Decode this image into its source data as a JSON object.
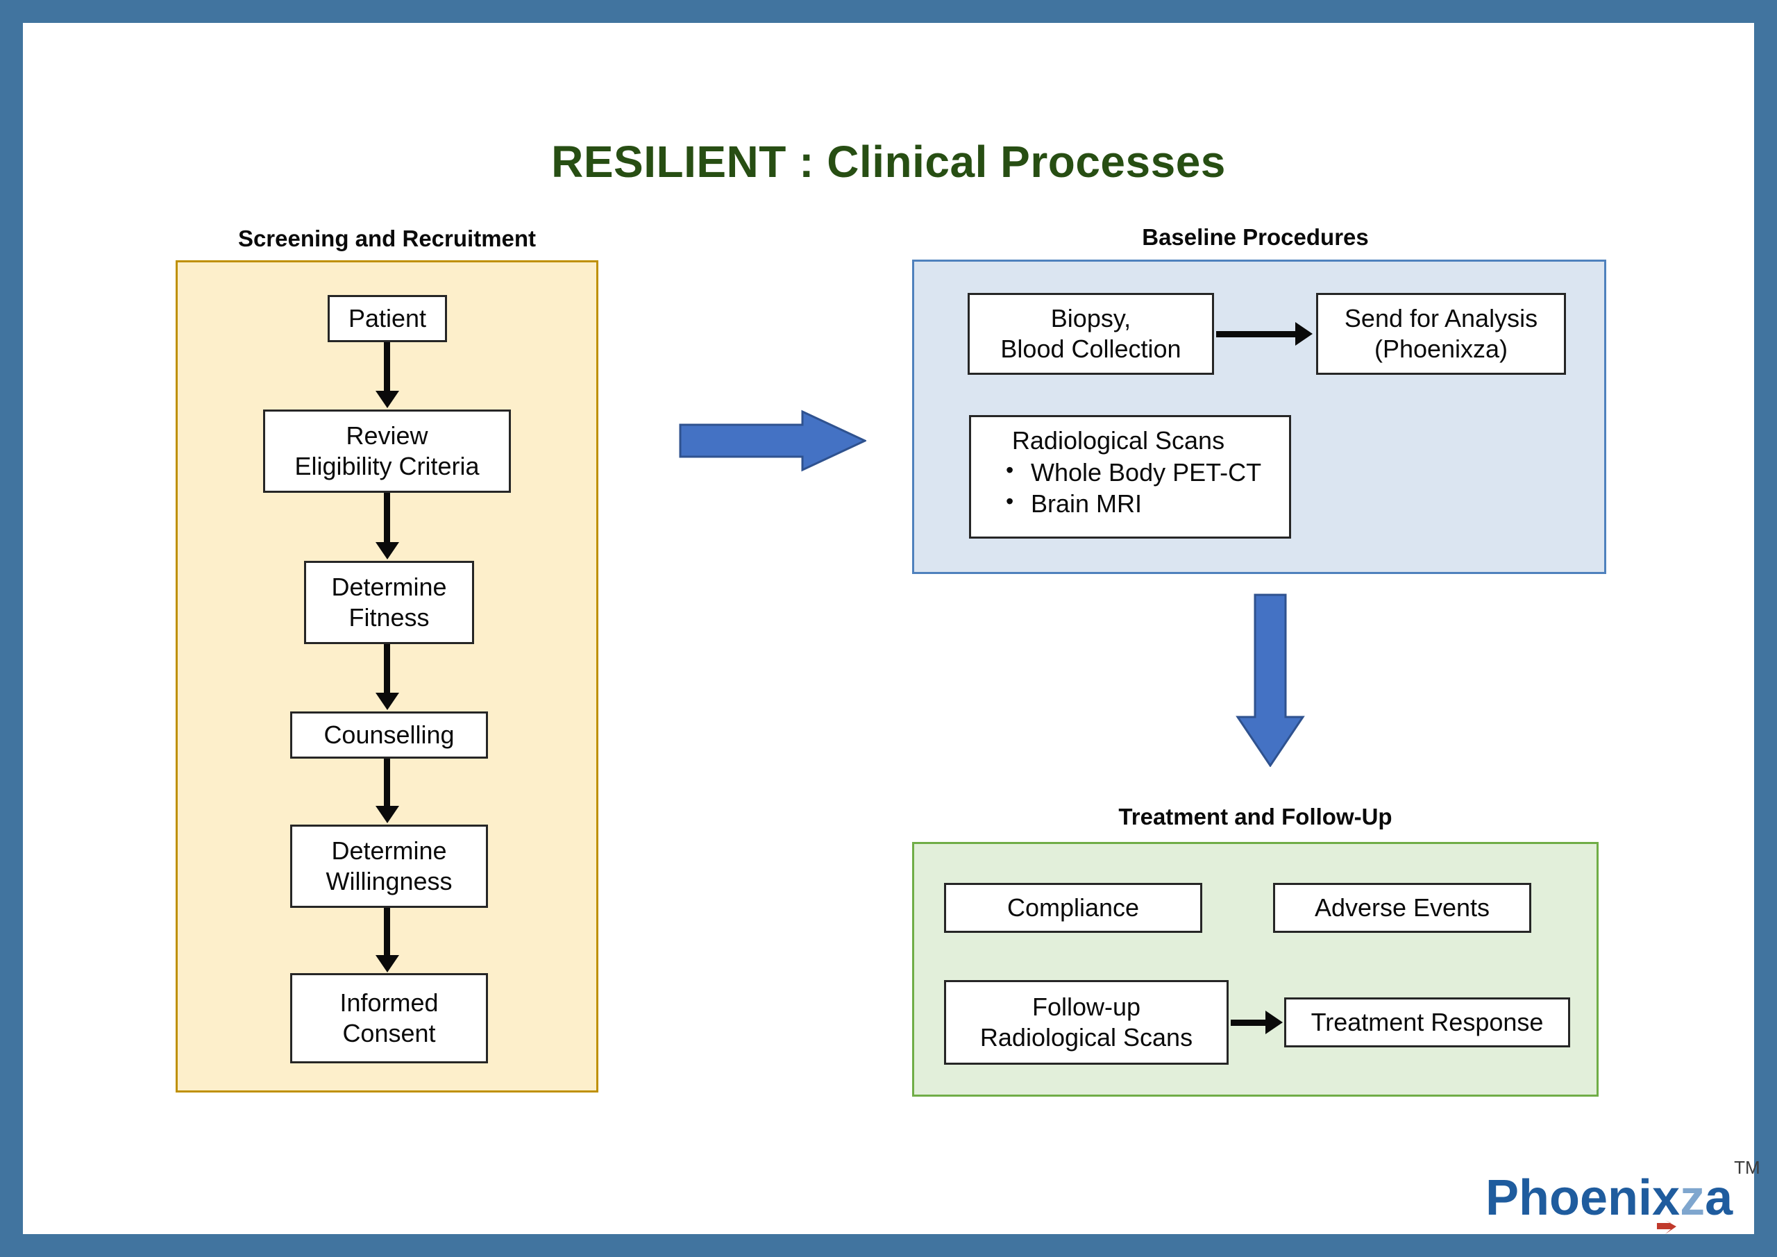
{
  "slide": {
    "title": "RESILIENT : Clinical Processes",
    "frame_color": "#41749F",
    "title_color": "#274E13",
    "background": "#FFFFFF"
  },
  "sections": {
    "screening": {
      "header": "Screening and Recruitment",
      "panel_fill": "#FDEFCB",
      "panel_border": "#BF9000",
      "steps": [
        {
          "label": "Patient"
        },
        {
          "label_line1": "Review",
          "label_line2": "Eligibility Criteria"
        },
        {
          "label_line1": "Determine",
          "label_line2": "Fitness"
        },
        {
          "label": "Counselling"
        },
        {
          "label_line1": "Determine",
          "label_line2": "Willingness"
        },
        {
          "label_line1": "Informed",
          "label_line2": "Consent"
        }
      ]
    },
    "baseline": {
      "header": "Baseline Procedures",
      "panel_fill": "#DBE5F1",
      "panel_border": "#4F81BD",
      "biopsy": {
        "line1": "Biopsy,",
        "line2": "Blood Collection"
      },
      "send_analysis": {
        "line1": "Send for Analysis",
        "line2": "(Phoenixza)"
      },
      "radiological": {
        "title": "Radiological Scans",
        "items": [
          "Whole Body PET-CT",
          "Brain MRI"
        ]
      }
    },
    "treatment": {
      "header": "Treatment and Follow-Up",
      "panel_fill": "#E2EFDA",
      "panel_border": "#70AD47",
      "compliance": "Compliance",
      "adverse_events": "Adverse Events",
      "followup_scans": {
        "line1": "Follow-up",
        "line2": "Radiological Scans"
      },
      "treatment_response": "Treatment Response"
    }
  },
  "arrows": {
    "screening_to_baseline": {
      "direction": "right",
      "fill": "#4472C4",
      "stroke": "#2F528F"
    },
    "baseline_to_treatment": {
      "direction": "down",
      "fill": "#4472C4",
      "stroke": "#2F528F"
    }
  },
  "logo": {
    "part1": "Phoenix",
    "part2": "z",
    "part3": "a",
    "trademark": "TM",
    "color_dark": "#1F5C9E",
    "color_light": "#7FA6CE",
    "swoosh_color": "#C0392B"
  }
}
